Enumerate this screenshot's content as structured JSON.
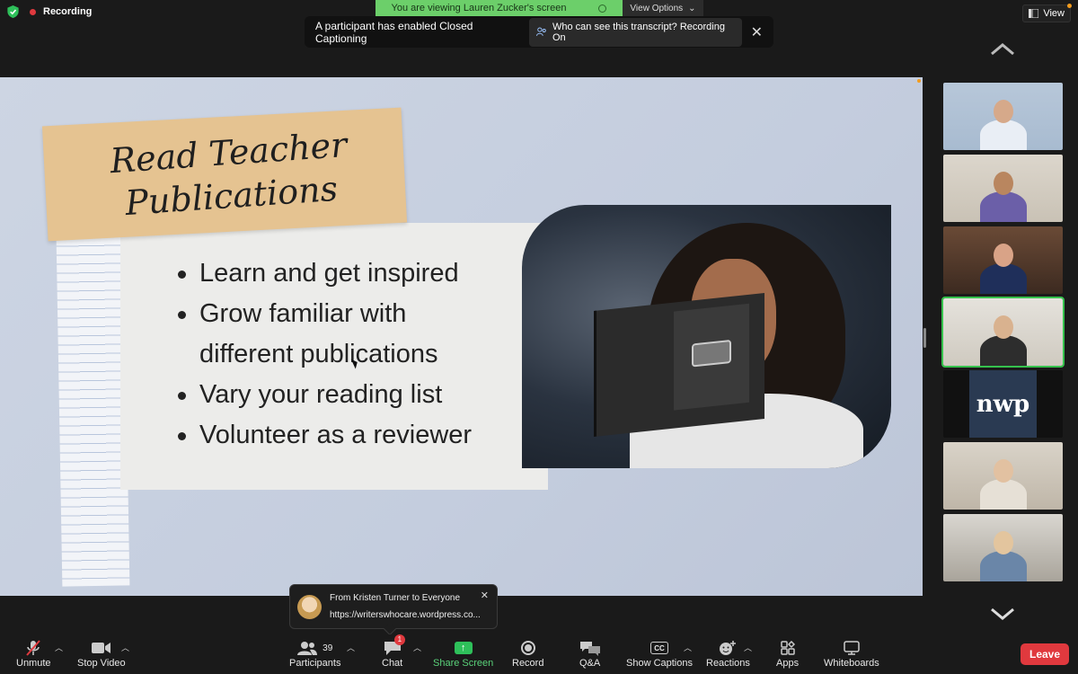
{
  "top": {
    "recording_label": "Recording",
    "viewing_banner": "You are viewing Lauren Zucker's screen",
    "view_options_label": "View Options",
    "view_label": "View"
  },
  "captions_banner": {
    "message": "A participant has enabled Closed Captioning",
    "who_button": "Who can see this transcript? Recording On"
  },
  "slide": {
    "title_line1": "Read Teacher",
    "title_line2": "Publications",
    "bullets": [
      "Learn and get inspired",
      "Grow familiar with",
      "different publications",
      "Vary your reading list",
      "Volunteer as a reviewer"
    ]
  },
  "sidebar": {
    "logo_text": "nwp"
  },
  "chat_popup": {
    "from": "From Kristen Turner to Everyone",
    "message": "https://writerswhocare.wordpress.co..."
  },
  "toolbar": {
    "unmute": "Unmute",
    "stop_video": "Stop Video",
    "participants": "Participants",
    "participants_count": "39",
    "chat": "Chat",
    "chat_badge": "1",
    "share_screen": "Share Screen",
    "record": "Record",
    "qa": "Q&A",
    "show_captions": "Show Captions",
    "cc_text": "CC",
    "reactions": "Reactions",
    "apps": "Apps",
    "whiteboards": "Whiteboards",
    "leave": "Leave"
  },
  "colors": {
    "share_green": "#6ccf6a",
    "leave_red": "#e0393e",
    "active_speaker": "#36c24d"
  }
}
